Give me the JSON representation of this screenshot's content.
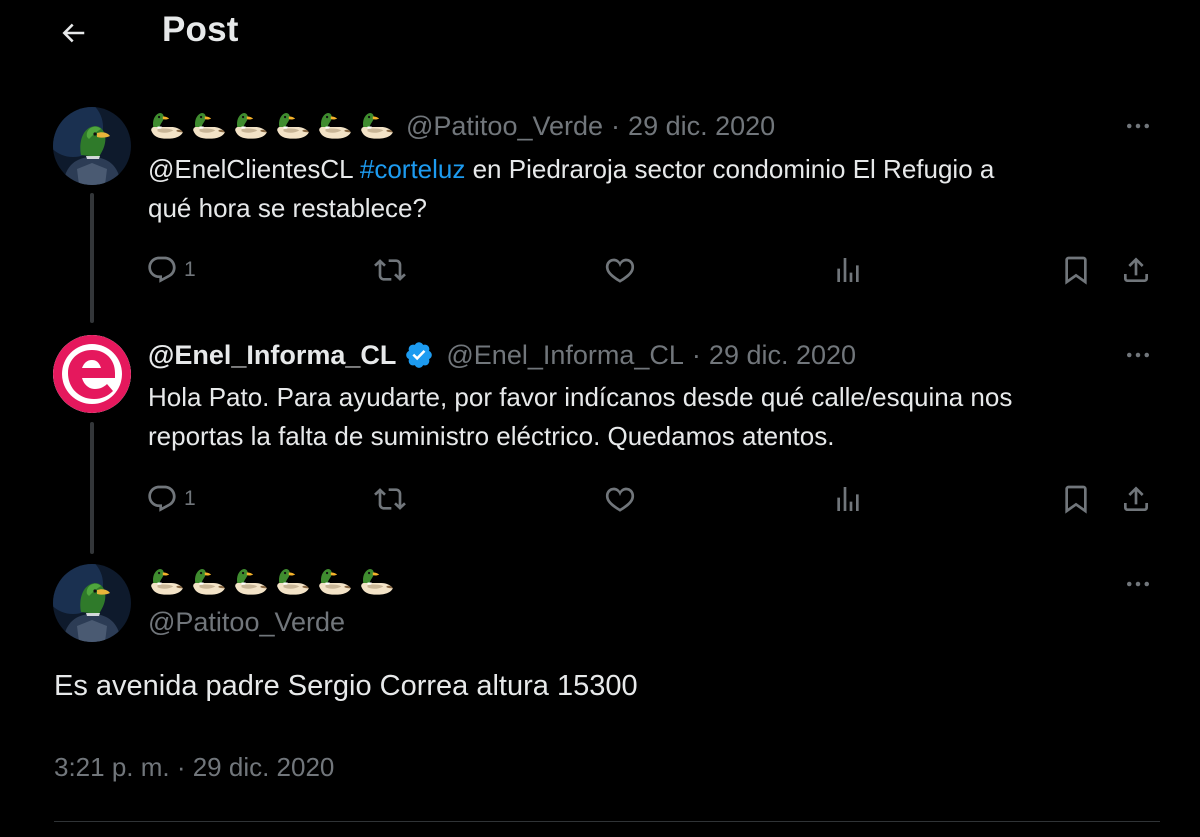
{
  "header": {
    "title": "Post"
  },
  "posts": [
    {
      "handle": "@Patitoo_Verde",
      "dot": "·",
      "date": "29 dic. 2020",
      "text_mention": "@EnelClientesCL",
      "text_hashtag": "#corteluz",
      "text_line1_rest": " en Piedraroja sector condominio El Refugio a",
      "text_line2": "qué hora se restablece?",
      "reply_count": "1"
    },
    {
      "display_name": "@Enel_Informa_CL",
      "handle": "@Enel_Informa_CL",
      "dot": "·",
      "date": "29 dic. 2020",
      "text_line1": "Hola Pato. Para ayudarte, por favor indícanos desde qué calle/esquina nos",
      "text_line2": "reportas la falta de suministro eléctrico. Quedamos atentos.",
      "reply_count": "1"
    }
  ],
  "main_post": {
    "handle": "@Patitoo_Verde",
    "text": "Es avenida padre Sergio Correa altura 15300",
    "timestamp": "3:21 p. m. · 29 dic. 2020"
  },
  "icons": {
    "back": "arrow-left-icon",
    "more": "more-horizontal-icon",
    "reply": "reply-icon",
    "repost": "repost-icon",
    "like": "heart-icon",
    "views": "views-icon",
    "bookmark": "bookmark-icon",
    "share": "share-icon",
    "verified": "verified-badge-icon",
    "duck": "duck-emoji-icon"
  },
  "colors": {
    "background": "#000000",
    "text": "#e7e9ea",
    "muted": "#71767b",
    "link": "#1d9bf0",
    "enel_brand": "#e5185d"
  }
}
